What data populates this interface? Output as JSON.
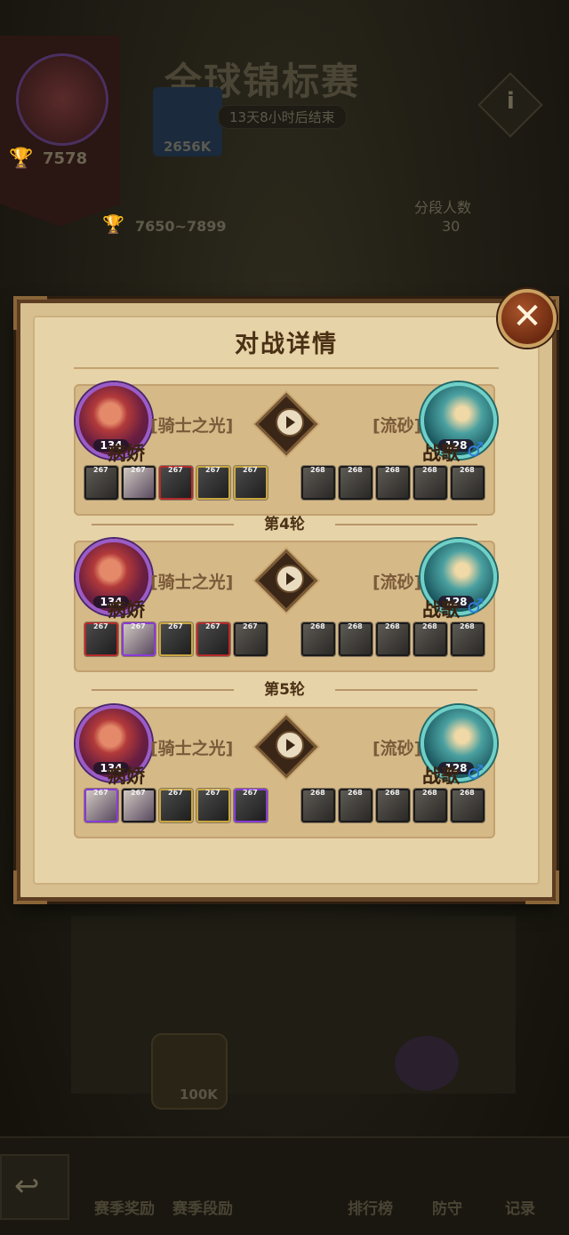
{
  "background": {
    "event_title": "全球锦标赛",
    "timer": "13天8小时后结束",
    "my_score": "7578",
    "guild_power": "2656K",
    "trophy_range": "7650~7899",
    "segment_label": "分段人数",
    "segment_count": "30",
    "gauge_value": "100K"
  },
  "bottom_nav": [
    "赛季奖励",
    "赛季段励",
    "排行榜",
    "防守",
    "记录"
  ],
  "modal": {
    "title": "对战详情",
    "close_glyph": "✕"
  },
  "matches": [
    {
      "left": {
        "name": "病娇",
        "guild": "[骑士之光]",
        "level": "134"
      },
      "right": {
        "name": "战歌",
        "guild": "[流砂]",
        "level": "128",
        "gender": "♂"
      },
      "left_heroes": [
        "267",
        "267",
        "267",
        "267",
        "267"
      ],
      "right_heroes": [
        "268",
        "268",
        "268",
        "268",
        "268"
      ]
    },
    {
      "round": "第4轮",
      "left": {
        "name": "病娇",
        "guild": "[骑士之光]",
        "level": "134"
      },
      "right": {
        "name": "战歌",
        "guild": "[流砂]",
        "level": "128",
        "gender": "♂"
      },
      "left_heroes": [
        "267",
        "267",
        "267",
        "267",
        "267"
      ],
      "right_heroes": [
        "268",
        "268",
        "268",
        "268",
        "268"
      ]
    },
    {
      "round": "第5轮",
      "left": {
        "name": "病娇",
        "guild": "[骑士之光]",
        "level": "134"
      },
      "right": {
        "name": "战歌",
        "guild": "[流砂]",
        "level": "128",
        "gender": "♂"
      },
      "left_heroes": [
        "267",
        "267",
        "267",
        "267",
        "267"
      ],
      "right_heroes": [
        "268",
        "268",
        "268",
        "268",
        "268"
      ]
    }
  ]
}
